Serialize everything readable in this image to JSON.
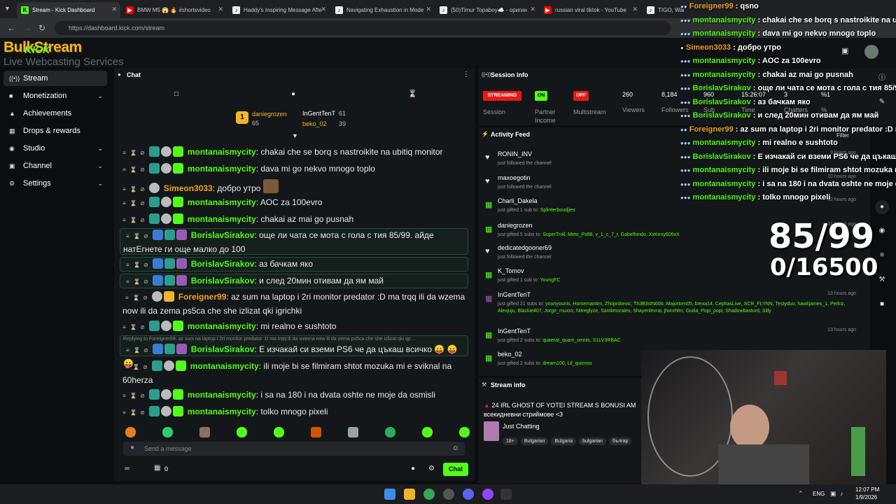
{
  "browser": {
    "tabs": [
      {
        "title": "Stream - Kick Dashboard",
        "active": true
      },
      {
        "title": "BMW M5 😱 🔥 #shortsvideo"
      },
      {
        "title": "Haddy's Inspiring Message Afte"
      },
      {
        "title": "Navigating Exhaustion in Mode"
      },
      {
        "title": "(50)Timur Topaboy☁️ - оригин"
      },
      {
        "title": "russian viral tiktok - YouTube"
      },
      {
        "title": "TIGO, Walker"
      }
    ],
    "url": "https://dashboard.kick.com/stream"
  },
  "brand": {
    "logo_text": "BulkStream",
    "kick_text": "KICK",
    "tagline": "Live Webcasting Services"
  },
  "sidebar": {
    "items": [
      {
        "label": "Stream",
        "icon": "broadcast-icon"
      },
      {
        "label": "Monetization",
        "icon": "dollar-icon"
      },
      {
        "label": "Achievements",
        "icon": "trophy-icon"
      },
      {
        "label": "Drops & rewards",
        "icon": "gift-icon"
      },
      {
        "label": "Studio",
        "icon": "studio-icon"
      },
      {
        "label": "Channel",
        "icon": "channel-icon"
      },
      {
        "label": "Settings",
        "icon": "gear-icon"
      }
    ]
  },
  "chat": {
    "title": "Chat",
    "leaderboard": {
      "first": {
        "name": "daniegrozen",
        "value": "65",
        "rank": "1"
      },
      "second": {
        "name": "InGentTenT",
        "value": "61"
      },
      "third": {
        "name": "beko_02",
        "value": "39"
      }
    },
    "messages": [
      {
        "user": "montanaismycity",
        "text": "chakai che se borq s nastroikite na ubitiq monitor"
      },
      {
        "user": "montanaismycity",
        "text": "dava mi go nekvo mnogo toplo"
      },
      {
        "user": "Simeon3033",
        "text": "добро утро"
      },
      {
        "user": "montanaismycity",
        "text": "AOC za 100evro"
      },
      {
        "user": "montanaismycity",
        "text": "chakai az mai go pusnah"
      },
      {
        "user": "BorislavSirakov",
        "text": "още ли чата се мота с гола с тия 85/99. айде",
        "text2": "натЕгнете ги още малко до 100"
      },
      {
        "user": "BorislavSirakov",
        "text": "аз бачкам яко"
      },
      {
        "user": "BorislavSirakov",
        "text": "и след 20мин отивам да ям май"
      },
      {
        "user": "Foreigner99",
        "text": "az sum na laptop i 2ri monitor predator :D ma trqq ili da wzema",
        "text2": "now ili da zema ps5ca che she izlizat qki igrichki"
      },
      {
        "user": "montanaismycity",
        "text": "mi realno e sushtoto"
      },
      {
        "reply": "Replying to Foreigner99: az sum na laptop i 2ri monitor predator :D ma trqq ili da wzema now ili da zema ps5ca che she izlizat qki igr...",
        "user": "BorislavSirakov",
        "text": "Е изчакай си вземи PS6 че да цъкаш всичко 😛 😛 😛"
      },
      {
        "user": "montanaismycity",
        "text": "ili moje bi se filmiram shtot mozuka mi e sviknal na",
        "text2": "60herza"
      },
      {
        "user": "montanaismycity",
        "text": "i sa na 180 i na dvata oshte ne moje da osmisli"
      },
      {
        "user": "montanaismycity",
        "text": "tolko mnogo pixeli"
      }
    ],
    "input_placeholder": "Send a message",
    "chat_button": "Chat",
    "points_value": "0",
    "accent": "#53fc18"
  },
  "session": {
    "title": "Session Info",
    "stats": [
      {
        "pill": "STREAMING",
        "label": "Session",
        "color": "#e91916"
      },
      {
        "pill": "ON",
        "label": "Partner Income",
        "color": "#53fc18"
      },
      {
        "pill": "OFF",
        "label": "Multistream",
        "color": "#e91916"
      },
      {
        "value": "260",
        "label": "Viewers"
      },
      {
        "value": "8,184",
        "label": "Followers"
      },
      {
        "value": "960",
        "label": "Sub"
      },
      {
        "value": "15:26:07",
        "label": "Time"
      },
      {
        "value": "3",
        "label": "Chatters"
      },
      {
        "value": "%1",
        "label": "%"
      }
    ]
  },
  "activity": {
    "title": "Activity Feed",
    "filter_label": "Filter",
    "items": [
      {
        "name": "RONIN_INV",
        "sub": "just followed the channel",
        "icon": "heart-icon",
        "time": "9 hours ago"
      },
      {
        "name": "maxoegotin",
        "sub": "just followed the channel",
        "icon": "heart-icon",
        "time": "10 hours ago"
      },
      {
        "name": "Charli_Dakela",
        "sub": "just gifted 1 sub to:",
        "targets": "Splinterboudjies",
        "icon": "gift-icon",
        "time": "12 hours ago"
      },
      {
        "name": "daniegrozen",
        "sub": "just gifted 5 subs to:",
        "targets": "SuperTroll, Meto_Px88, v_1_c_7_r, Gabeflorido, XxKeny606xX",
        "icon": "gift-icon",
        "time": "11 hours ago"
      },
      {
        "name": "dedicatedgooner69",
        "sub": "just followed the channel",
        "icon": "heart-icon",
        "time": ""
      },
      {
        "name": "K_Tomov",
        "sub": "just gifted 1 sub to:",
        "targets": "YoungFC",
        "icon": "gift-icon",
        "time": ""
      },
      {
        "name": "InGentTenT",
        "sub": "just gifted 21 subs to:",
        "targets": "younyounis, Horsemantim, Zhopnikevic, Th3B3stN00b, Majortom05, brexa14, CephasLive, SCR_FLYNN, Testyduo, hawkjames_1, Perkiz, Alexjuju, Blackie407, Jorge_muxxx, Nitreglyze, Santiimorales, Shayenlevrai, jhonrhlm, Giulia_Popi_popi, Shadowbasturd, Silly",
        "icon": "gift-icon",
        "time": "13 hours ago"
      },
      {
        "name": "InGentTenT",
        "sub": "just gifted 2 subs to:",
        "targets": "quaerat_quam_omnis, S1LV3RBAC",
        "icon": "gift-icon",
        "time": "13 hours ago"
      },
      {
        "name": "beko_02",
        "sub": "just gifted 2 subs to:",
        "targets": "dream100, Lil_quiznos",
        "icon": "gift-icon",
        "time": ""
      }
    ]
  },
  "stream_info": {
    "title": "Stream info",
    "stream_title": "24 IRL GHOST OF YOTEI STREAM S BONUSI AM",
    "stream_title2": "всекидневни стриймове <3",
    "category": "Just Chatting",
    "tags": [
      "18+",
      "Bulgarian",
      "Bulgaria",
      "bulgarian",
      "българ"
    ]
  },
  "overlay": {
    "lines": [
      {
        "user": "Foreigner99",
        "text": "qsno"
      },
      {
        "user": "montanaismycity",
        "text": "chakai che se borq s nastroikite na ub"
      },
      {
        "user": "montanaismycity",
        "text": "dava mi go nekvo mnogo toplo"
      },
      {
        "user": "Simeon3033",
        "text": "добро утро"
      },
      {
        "user": "montanaismycity",
        "text": "AOC za 100evro"
      },
      {
        "user": "montanaismycity",
        "text": "chakai az mai go pusnah"
      },
      {
        "user": "BorislavSirakov",
        "text": "още ли чата се мота с гола с тия 85/99"
      },
      {
        "user": "BorislavSirakov",
        "text": "аз бачкам яко"
      },
      {
        "user": "BorislavSirakov",
        "text": "и след 20мин отивам да ям май"
      },
      {
        "user": "Foreigner99",
        "text": "az sum na laptop i 2ri monitor predator :D ma"
      },
      {
        "user": "montanaismycity",
        "text": "mi realno e sushtoto"
      },
      {
        "user": "BorislavSirakov",
        "text": "Е изчакай си вземи PS6 че да цъкаш"
      },
      {
        "user": "montanaismycity",
        "text": "ili moje bi se filmiram shtot mozuka m"
      },
      {
        "user": "montanaismycity",
        "text": "i sa na 180 i na dvata oshte ne moje da"
      },
      {
        "user": "montanaismycity",
        "text": "tolko mnogo pixeli"
      }
    ],
    "goal1": "85/99",
    "goal2": "0/16500"
  },
  "taskbar": {
    "lang": "ENG",
    "time": "12:07 PM",
    "date": "1/9/2026"
  }
}
